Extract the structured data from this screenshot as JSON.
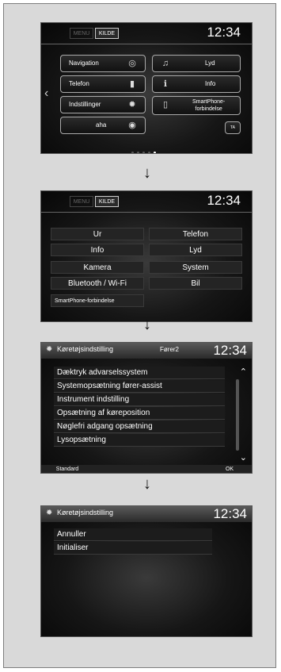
{
  "screen1": {
    "tabs": [
      "MENU",
      "KILDE"
    ],
    "clock": "12:34",
    "buttons": {
      "navigation": "Navigation",
      "telefon": "Telefon",
      "indstillinger": "Indstillinger",
      "aha": "aha",
      "lyd": "Lyd",
      "info": "Info",
      "smartphone": "SmartPhone-\nforbindelse",
      "ta": "TA"
    }
  },
  "screen2": {
    "tabs": [
      "MENU",
      "KILDE"
    ],
    "clock": "12:34",
    "left": [
      "Ur",
      "Info",
      "Kamera",
      "Bluetooth / Wi-Fi"
    ],
    "right": [
      "Telefon",
      "Lyd",
      "System",
      "Bil"
    ],
    "bottom": "SmartPhone-forbindelse"
  },
  "screen3": {
    "title": "Køretøjsindstilling",
    "driver": "Fører2",
    "clock": "12:34",
    "items": [
      "Dæktryk advarselssystem",
      "Systemopsætning fører-assist",
      "Instrument indstilling",
      "Opsætning af køreposition",
      "Nøglefri adgang opsætning",
      "Lysopsætning"
    ],
    "standard_label": "Standard",
    "ok_label": "OK"
  },
  "screen4": {
    "title": "Køretøjsindstilling",
    "clock": "12:34",
    "items": [
      "Annuller",
      "Initialiser"
    ]
  },
  "arrow_glyph": "➔",
  "colors": {
    "panel": "#d9d9d9",
    "screen_bg": "#0e0e0e",
    "text": "#ffffff"
  }
}
